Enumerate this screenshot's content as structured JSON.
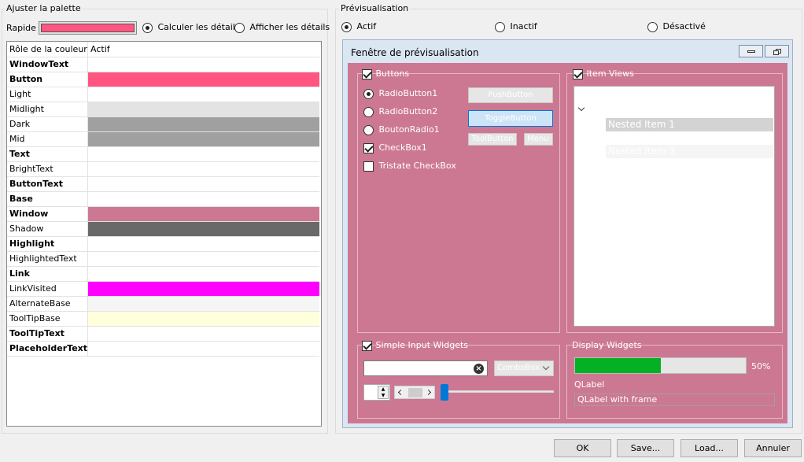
{
  "palette": {
    "title": "Ajuster la palette",
    "quick_label": "Rapide",
    "quick_color": "#ff5580",
    "radio_compute": "Calculer les détails",
    "radio_show": "Afficher les détails",
    "table_header": {
      "role": "Rôle de la couleur",
      "active": "Actif"
    },
    "roles": [
      {
        "name": "WindowText",
        "bold": true,
        "color": "#ffffff"
      },
      {
        "name": "Button",
        "bold": true,
        "color": "#ff5580"
      },
      {
        "name": "Light",
        "bold": false,
        "color": "#ffffff"
      },
      {
        "name": "Midlight",
        "bold": false,
        "color": "#e3e3e3"
      },
      {
        "name": "Dark",
        "bold": false,
        "color": "#a0a0a0"
      },
      {
        "name": "Mid",
        "bold": false,
        "color": "#a0a0a0"
      },
      {
        "name": "Text",
        "bold": true,
        "color": "#ffffff"
      },
      {
        "name": "BrightText",
        "bold": false,
        "color": "#ffffff"
      },
      {
        "name": "ButtonText",
        "bold": true,
        "color": "#ffffff"
      },
      {
        "name": "Base",
        "bold": true,
        "color": "#ffffff"
      },
      {
        "name": "Window",
        "bold": true,
        "color": "#cc7893"
      },
      {
        "name": "Shadow",
        "bold": false,
        "color": "#696969"
      },
      {
        "name": "Highlight",
        "bold": true,
        "color": "#ffffff"
      },
      {
        "name": "HighlightedText",
        "bold": false,
        "color": "#ffffff"
      },
      {
        "name": "Link",
        "bold": true,
        "color": "#ffffff"
      },
      {
        "name": "LinkVisited",
        "bold": false,
        "color": "#ff00ff"
      },
      {
        "name": "AlternateBase",
        "bold": false,
        "color": "#f5f5f5"
      },
      {
        "name": "ToolTipBase",
        "bold": false,
        "color": "#ffffdc"
      },
      {
        "name": "ToolTipText",
        "bold": true,
        "color": "#ffffff"
      },
      {
        "name": "PlaceholderText",
        "bold": true,
        "color": "#ffffff"
      }
    ]
  },
  "preview": {
    "title": "Prévisualisation",
    "radio_active": "Actif",
    "radio_inactive": "Inactif",
    "radio_disabled": "Désactivé",
    "window_title": "Fenêtre de prévisualisation",
    "window_color": "#cc7893",
    "buttons_group": "Buttons",
    "radio1": "RadioButton1",
    "radio2": "RadioButton2",
    "radio3": "BoutonRadio1",
    "checkbox1": "CheckBox1",
    "tristate": "Tristate CheckBox",
    "push": "PushButton",
    "toggle": "ToggleButton",
    "toolbutton": "ToolButton",
    "menu": "Menu",
    "item_views_group": "Item Views",
    "nested1": "Nested Item 1",
    "nested2": "Nested Item 3",
    "simple_input_group": "Simple Input Widgets",
    "combobox": "ComboBox",
    "display_group": "Display Widgets",
    "progress_value": 50,
    "progress_text": "50%",
    "progress_color": "#06b025",
    "qlabel": "QLabel",
    "qlabel_frame": "QLabel with frame"
  },
  "buttons": {
    "ok": "OK",
    "save": "Save...",
    "load": "Load...",
    "cancel": "Annuler"
  }
}
